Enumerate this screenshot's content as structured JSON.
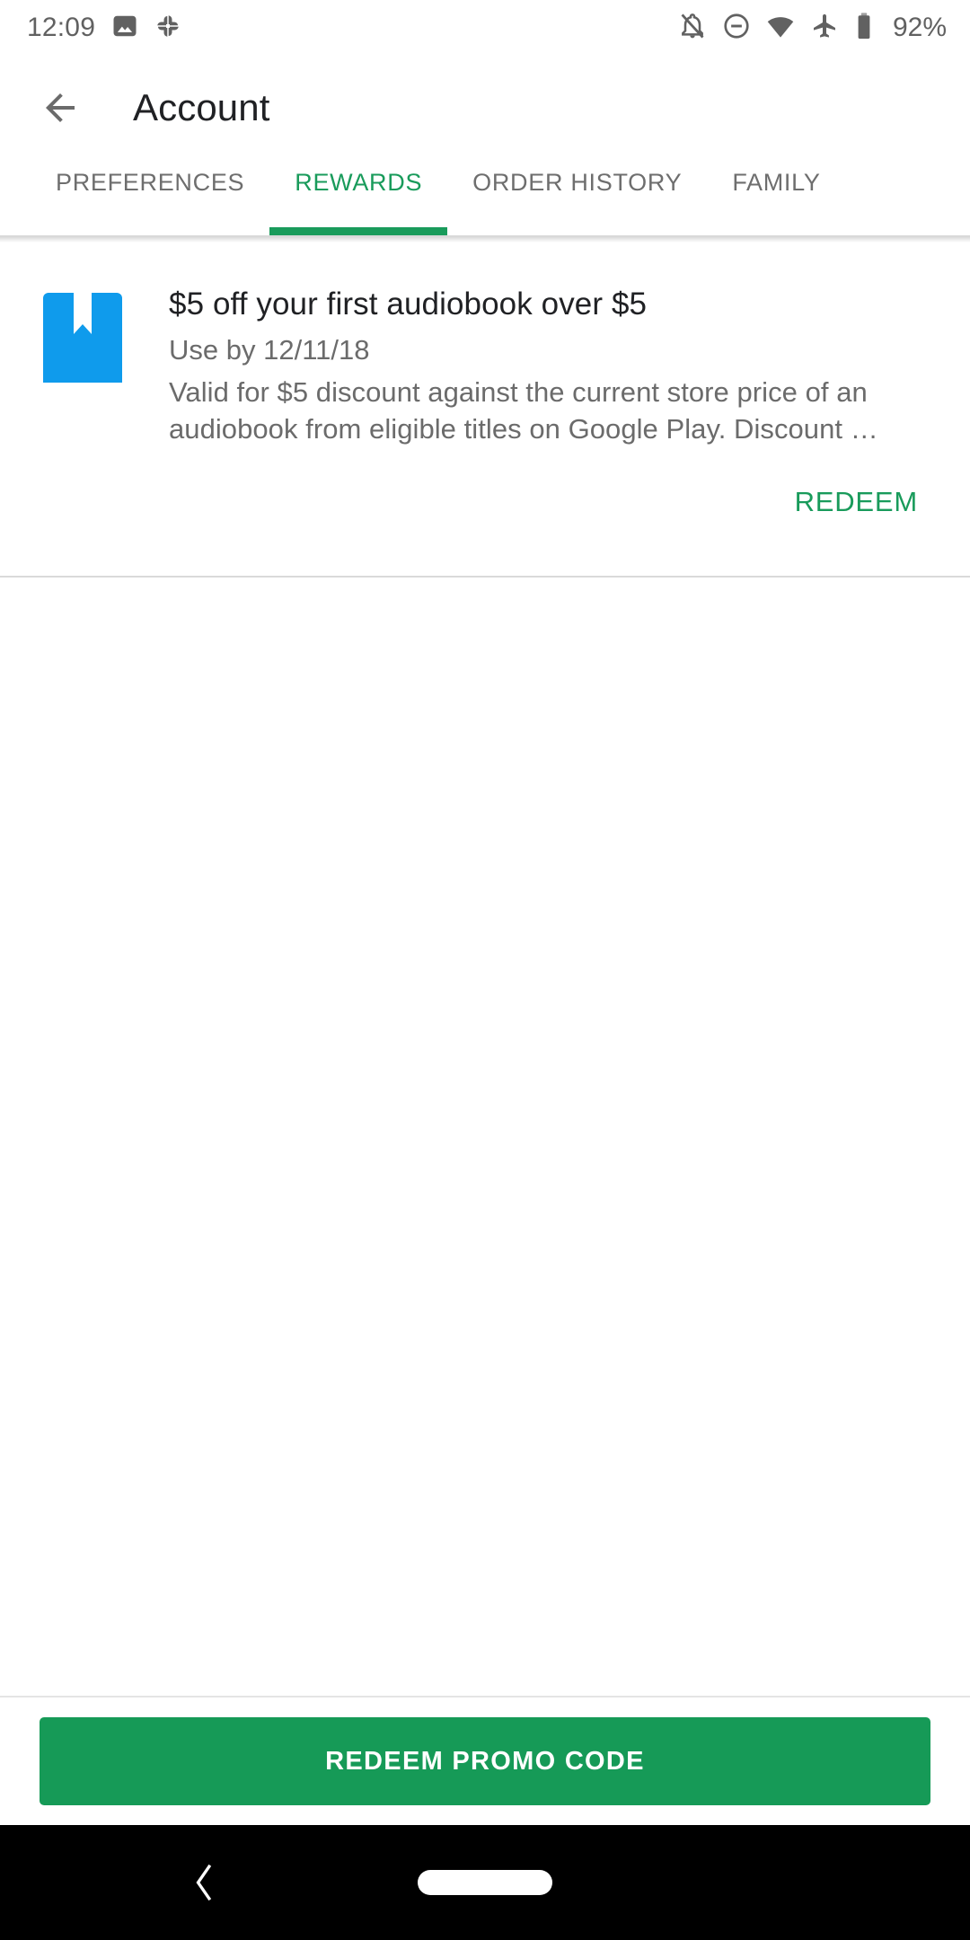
{
  "status_bar": {
    "time": "12:09",
    "battery_percent": "92%",
    "left_icons": [
      "photo-icon",
      "google-photos-pinwheel-icon"
    ],
    "right_icons": [
      "notifications-off-icon",
      "do-not-disturb-icon",
      "wifi-icon",
      "airplane-mode-icon",
      "battery-icon"
    ]
  },
  "app_bar": {
    "back_icon": "back-arrow-icon",
    "title": "Account"
  },
  "tabs": {
    "active_index": 1,
    "items": [
      {
        "label": "PREFERENCES"
      },
      {
        "label": "REWARDS"
      },
      {
        "label": "ORDER HISTORY"
      },
      {
        "label": "FAMILY"
      }
    ]
  },
  "reward": {
    "icon": "book-bookmark-icon",
    "icon_color": "#0f9bec",
    "title": "$5 off your first audiobook over $5",
    "expiry": "Use by 12/11/18",
    "description": "Valid for $5 discount against the current store price of an audiobook from eligible titles on Google Play. Discount …",
    "redeem_label": "REDEEM"
  },
  "bottom": {
    "promo_button_label": "REDEEM PROMO CODE"
  },
  "nav_bar": {
    "back_icon": "nav-back-chevron-icon",
    "home_icon": "nav-home-pill-icon"
  },
  "colors": {
    "accent_green": "#199b5b",
    "button_green": "#169a57",
    "icon_blue": "#0f9bec",
    "text_primary": "#202124",
    "text_secondary": "#6b6b6b"
  }
}
